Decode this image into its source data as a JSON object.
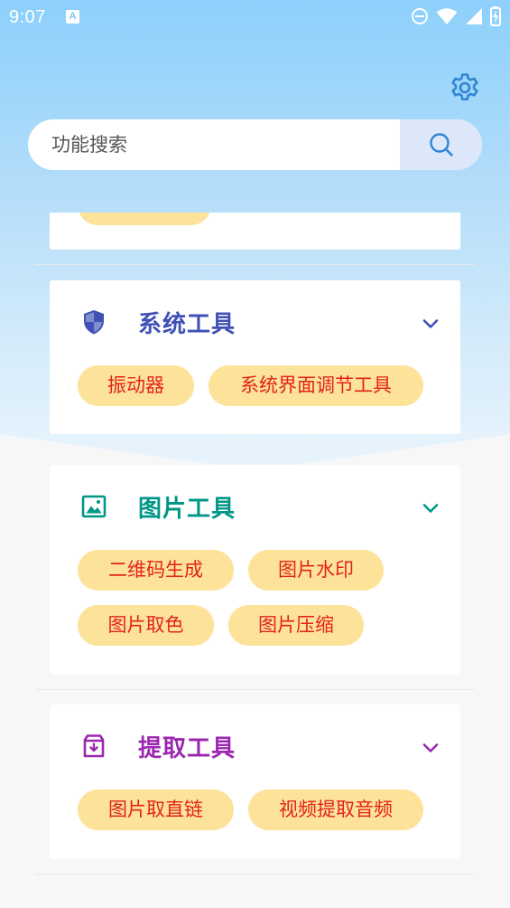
{
  "status_bar": {
    "time": "9:07",
    "notification_icon": "a-notification-icon",
    "icons": [
      "do-not-disturb-icon",
      "wifi-icon",
      "signal-icon",
      "battery-charging-icon"
    ]
  },
  "header": {
    "settings_icon": "gear-icon"
  },
  "search": {
    "placeholder": "功能搜索",
    "button_icon": "search-icon"
  },
  "sections": [
    {
      "title": "",
      "partially_visible": true,
      "chips": []
    },
    {
      "title": "系统工具",
      "icon": "shield-icon",
      "color": "#3f51b5",
      "expanded": true,
      "chips": [
        "振动器",
        "系统界面调节工具"
      ]
    },
    {
      "title": "图片工具",
      "icon": "image-icon",
      "color": "#009688",
      "expanded": true,
      "chips": [
        "二维码生成",
        "图片水印",
        "图片取色",
        "图片压缩"
      ]
    },
    {
      "title": "提取工具",
      "icon": "archive-download-icon",
      "color": "#9c27b0",
      "expanded": true,
      "chips": [
        "图片取直链",
        "视频提取音频"
      ]
    }
  ],
  "colors": {
    "chip_background": "#fde29a",
    "chip_text": "#e2231a",
    "accent_blue": "#2f86d6"
  }
}
